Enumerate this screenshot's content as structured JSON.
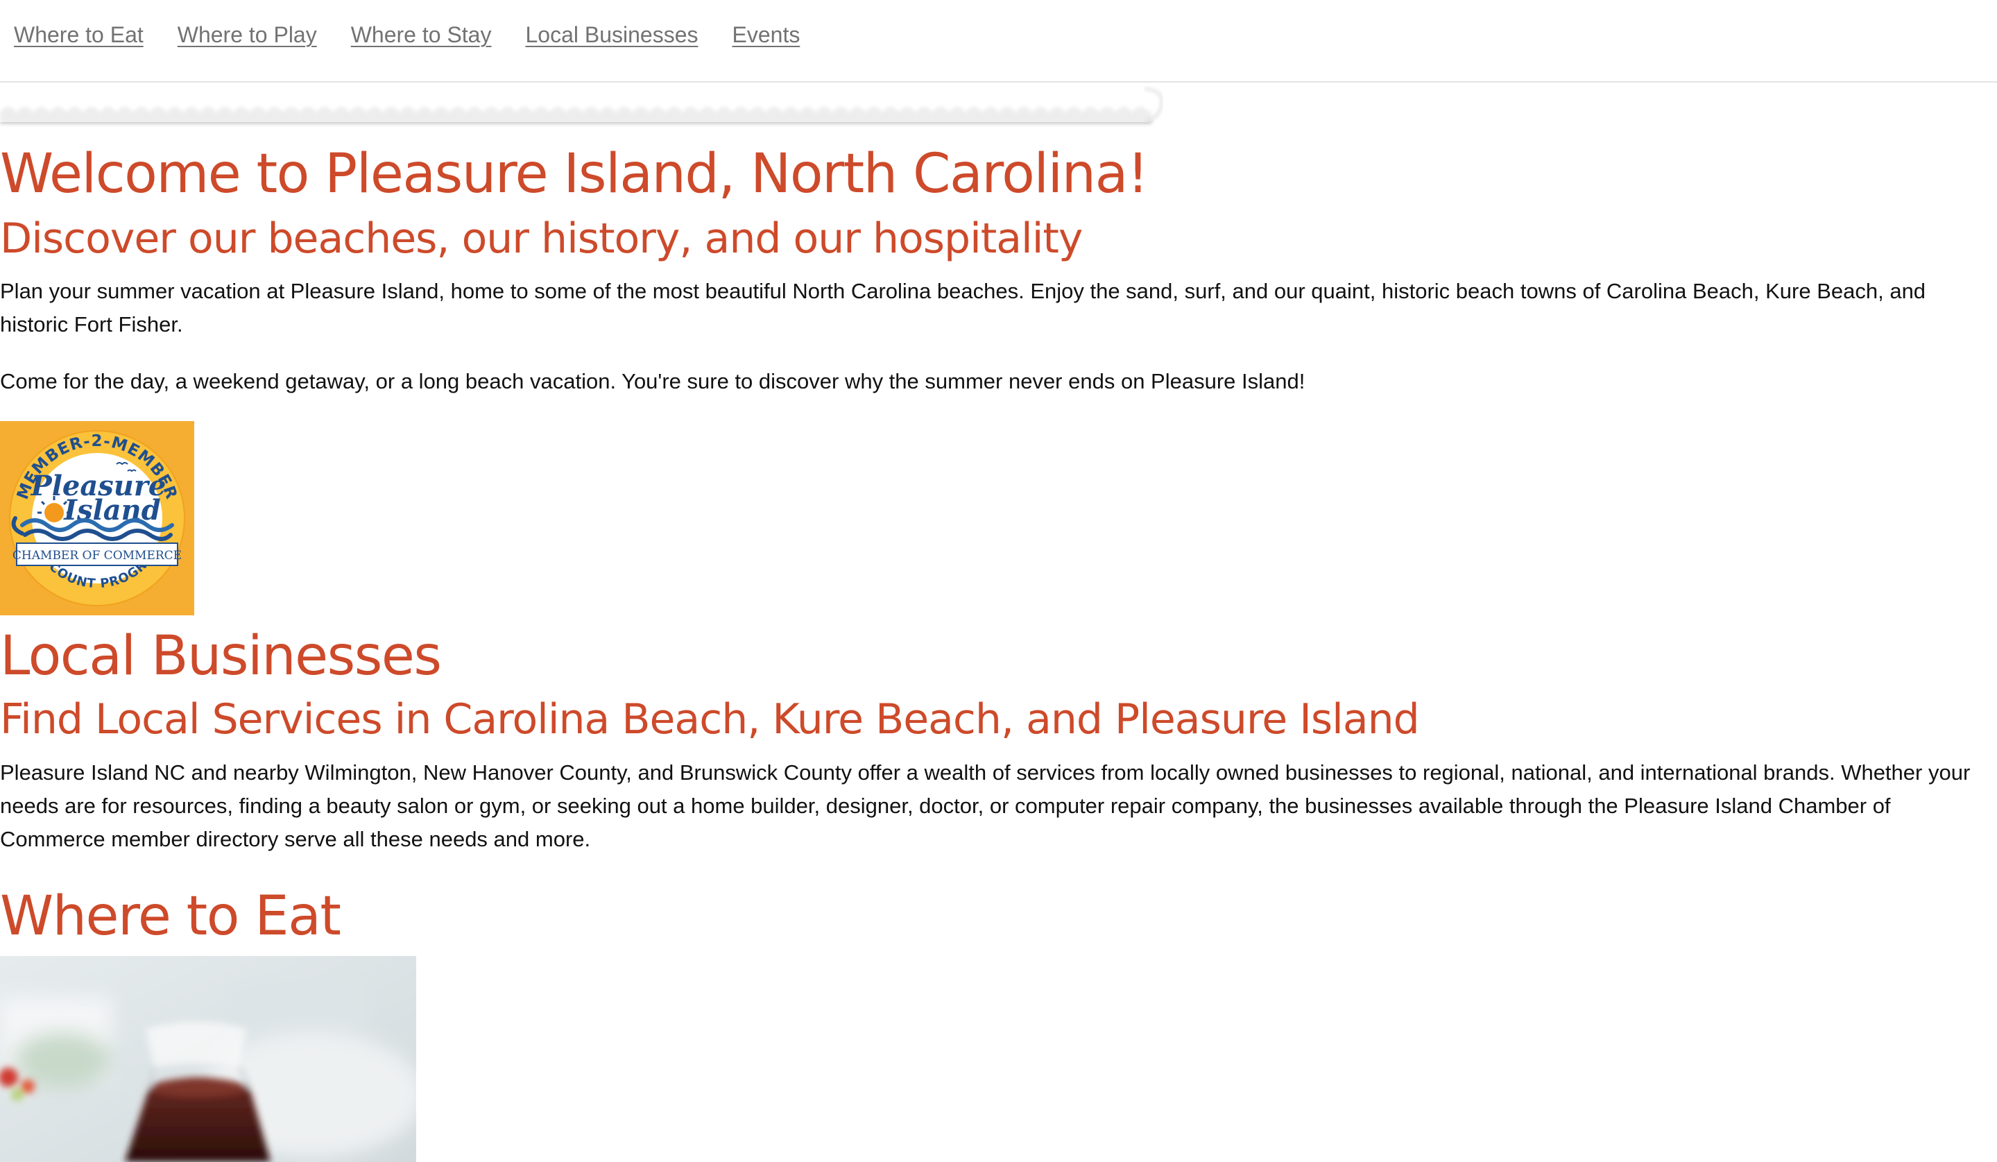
{
  "nav": {
    "items": [
      {
        "label": "Where to Eat"
      },
      {
        "label": "Where to Play"
      },
      {
        "label": "Where to Stay"
      },
      {
        "label": "Local Businesses"
      },
      {
        "label": "Events"
      }
    ]
  },
  "welcome": {
    "title": "Welcome to Pleasure Island, North Carolina!",
    "subtitle": "Discover our beaches, our history, and our hospitality",
    "paragraph1": "Plan your summer vacation at Pleasure Island, home to some of the most beautiful North Carolina beaches. Enjoy the sand, surf, and our quaint, historic beach towns of Carolina Beach, Kure Beach, and historic Fort Fisher.",
    "paragraph2": "Come for the day, a weekend getaway, or a long beach vacation. You're sure to discover why the summer never ends on Pleasure Island!"
  },
  "logo": {
    "top_text": "MEMBER-2-MEMBER",
    "name_line1": "Pleasure",
    "name_line2": "Island",
    "band_text": "CHAMBER OF COMMERCE",
    "bottom_text": "DISCOUNT PROGRAM",
    "colors": {
      "gold": "#f7b733",
      "navy": "#1f4f8f",
      "sun": "#f39a1e"
    }
  },
  "local_businesses": {
    "title": "Local Businesses",
    "subtitle": "Find Local Services in Carolina Beach, Kure Beach, and Pleasure Island",
    "paragraph": "Pleasure Island NC and nearby Wilmington, New Hanover County, and Brunswick County offer a wealth of services from locally owned businesses to regional, national, and international brands. Whether your needs are for resources, finding a beauty salon or gym, or seeking out a home builder, designer, doctor, or computer repair company, the businesses available through the Pleasure Island Chamber of Commerce member directory serve all these needs and more."
  },
  "where_to_eat": {
    "title": "Where to Eat"
  },
  "colors": {
    "heading": "#cd4a2a",
    "nav_link": "#727272",
    "body_text": "#111111"
  }
}
